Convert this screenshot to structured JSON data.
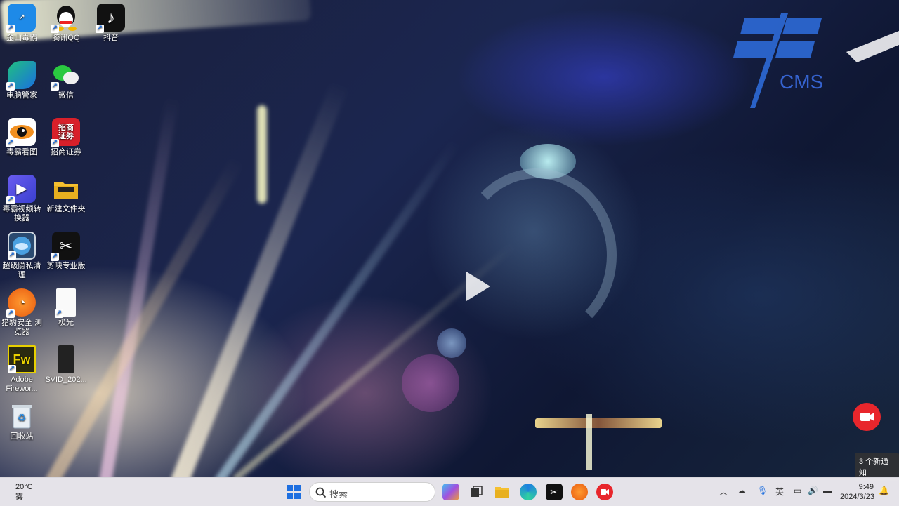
{
  "desktop": {
    "icons": [
      {
        "label": "金山毒霸",
        "icon": "jinshan-duba-icon"
      },
      {
        "label": "腾讯QQ",
        "icon": "qq-icon"
      },
      {
        "label": "抖音",
        "icon": "douyin-icon"
      },
      {
        "label": "电脑管家",
        "icon": "pc-manager-icon"
      },
      {
        "label": "微信",
        "icon": "wechat-icon"
      },
      {
        "label": "毒霸看图",
        "icon": "image-viewer-icon"
      },
      {
        "label": "招商证券",
        "icon": "cms-securities-icon",
        "glyph_text": "招商证券"
      },
      {
        "label": "毒霸视频转换器",
        "icon": "video-converter-icon"
      },
      {
        "label": "新建文件夹",
        "icon": "folder-icon"
      },
      {
        "label": "超级隐私清理",
        "icon": "privacy-cleaner-icon"
      },
      {
        "label": "剪映专业版",
        "icon": "capcut-icon"
      },
      {
        "label": "猎豹安全 浏览器",
        "icon": "cheetah-browser-icon"
      },
      {
        "label": "极光",
        "icon": "document-icon"
      },
      {
        "label": "Adobe Firewor...",
        "icon": "fireworks-icon",
        "glyph_text": "Fw"
      },
      {
        "label": "SVID_202...",
        "icon": "video-file-icon"
      },
      {
        "label": "回收站",
        "icon": "recycle-bin-icon"
      }
    ],
    "wallpaper_logo_text": "CMS"
  },
  "taskbar": {
    "weather": {
      "temp": "20°C",
      "condition": "雾"
    },
    "search_placeholder": "搜索",
    "pinned": [
      "windows-start-icon",
      "copilot-icon",
      "task-view-icon",
      "file-explorer-icon",
      "edge-icon",
      "capcut-icon",
      "cheetah-browser-icon",
      "screen-recorder-icon"
    ],
    "tray": {
      "ime": "英"
    },
    "clock": {
      "time": "9:49",
      "date": "2024/3/23"
    }
  },
  "notification": {
    "text": "3 个新通知"
  },
  "colors": {
    "accent": "#1e6fe0",
    "taskbar_bg": "#eeecf0",
    "wallpaper_base": "#1b2650"
  }
}
